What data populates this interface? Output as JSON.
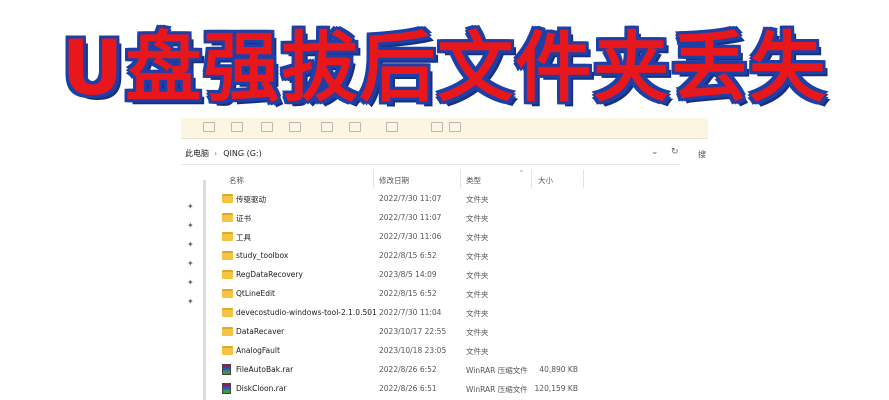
{
  "headline": "U盘强拔后文件夹丢失",
  "address_bar": {
    "root": "此电脑",
    "separator": "›",
    "drive": "QING (G:)",
    "dropdown_glyph": "⌄",
    "refresh_glyph": "↻",
    "search_label": "搜"
  },
  "quick_access_pin_glyph": "✦",
  "columns": {
    "name": "名称",
    "date": "修改日期",
    "type": "类型",
    "size": "大小",
    "sort_glyph": "^"
  },
  "files": [
    {
      "name": "传驱驱动",
      "date": "2022/7/30 11:07",
      "type": "文件夹",
      "size": "",
      "icon": "folder-icon"
    },
    {
      "name": "证书",
      "date": "2022/7/30 11:07",
      "type": "文件夹",
      "size": "",
      "icon": "folder-icon"
    },
    {
      "name": "工具",
      "date": "2022/7/30 11:06",
      "type": "文件夹",
      "size": "",
      "icon": "folder-icon"
    },
    {
      "name": "study_toolbox",
      "date": "2022/8/15 6:52",
      "type": "文件夹",
      "size": "",
      "icon": "folder-icon"
    },
    {
      "name": "RegDataRecovery",
      "date": "2023/8/5 14:09",
      "type": "文件夹",
      "size": "",
      "icon": "folder-icon"
    },
    {
      "name": "QtLineEdit",
      "date": "2022/8/15 6:52",
      "type": "文件夹",
      "size": "",
      "icon": "folder-icon"
    },
    {
      "name": "devecostudio-windows-tool-2.1.0.501",
      "date": "2022/7/30 11:04",
      "type": "文件夹",
      "size": "",
      "icon": "folder-icon"
    },
    {
      "name": "DataRecaver",
      "date": "2023/10/17 22:55",
      "type": "文件夹",
      "size": "",
      "icon": "folder-icon"
    },
    {
      "name": "AnalogFault",
      "date": "2023/10/18 23:05",
      "type": "文件夹",
      "size": "",
      "icon": "folder-icon"
    },
    {
      "name": "FileAutoBak.rar",
      "date": "2022/8/26 6:52",
      "type": "WinRAR 压缩文件",
      "size": "40,890 KB",
      "icon": "winrar-archive-icon"
    },
    {
      "name": "DiskCloon.rar",
      "date": "2022/8/26 6:51",
      "type": "WinRAR 压缩文件",
      "size": "120,159 KB",
      "icon": "winrar-archive-icon"
    }
  ],
  "colors": {
    "headline_fill": "#e8171c",
    "headline_outline": "#1d3fa8",
    "ribbon_bg": "#fbf5e2",
    "folder": "#f5c542"
  }
}
